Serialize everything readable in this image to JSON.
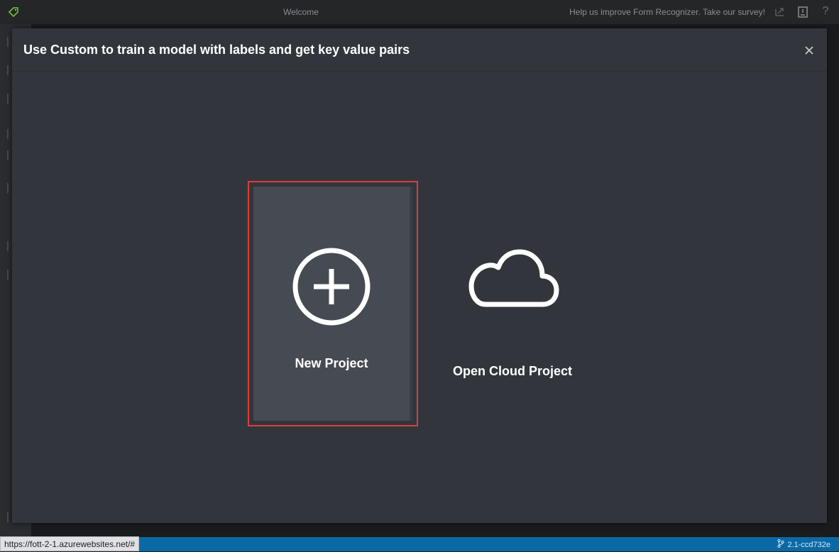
{
  "titlebar": {
    "title": "Welcome",
    "survey_text": "Help us improve Form Recognizer. Take our survey!",
    "help_glyph": "?",
    "icons": [
      "tag-logo-icon",
      "share-icon",
      "report-icon",
      "help-icon"
    ]
  },
  "modal": {
    "title": "Use Custom to train a model with labels and get key value pairs",
    "close_icon": "close-icon"
  },
  "cards": {
    "new_project": {
      "label": "New Project",
      "icon": "plus-circle-icon"
    },
    "open_cloud_project": {
      "label": "Open Cloud Project",
      "icon": "cloud-icon"
    }
  },
  "statusbar": {
    "url": "https://fott-2-1.azurewebsites.net/#",
    "version": "2.1-ccd732e",
    "version_icon": "branch-icon"
  },
  "colors": {
    "accent_highlight": "#e03c3c",
    "modal_bg": "#32363c",
    "card_bg": "#464a52",
    "status_bar": "#0b6aa6",
    "logo_green": "#6fc23a"
  }
}
